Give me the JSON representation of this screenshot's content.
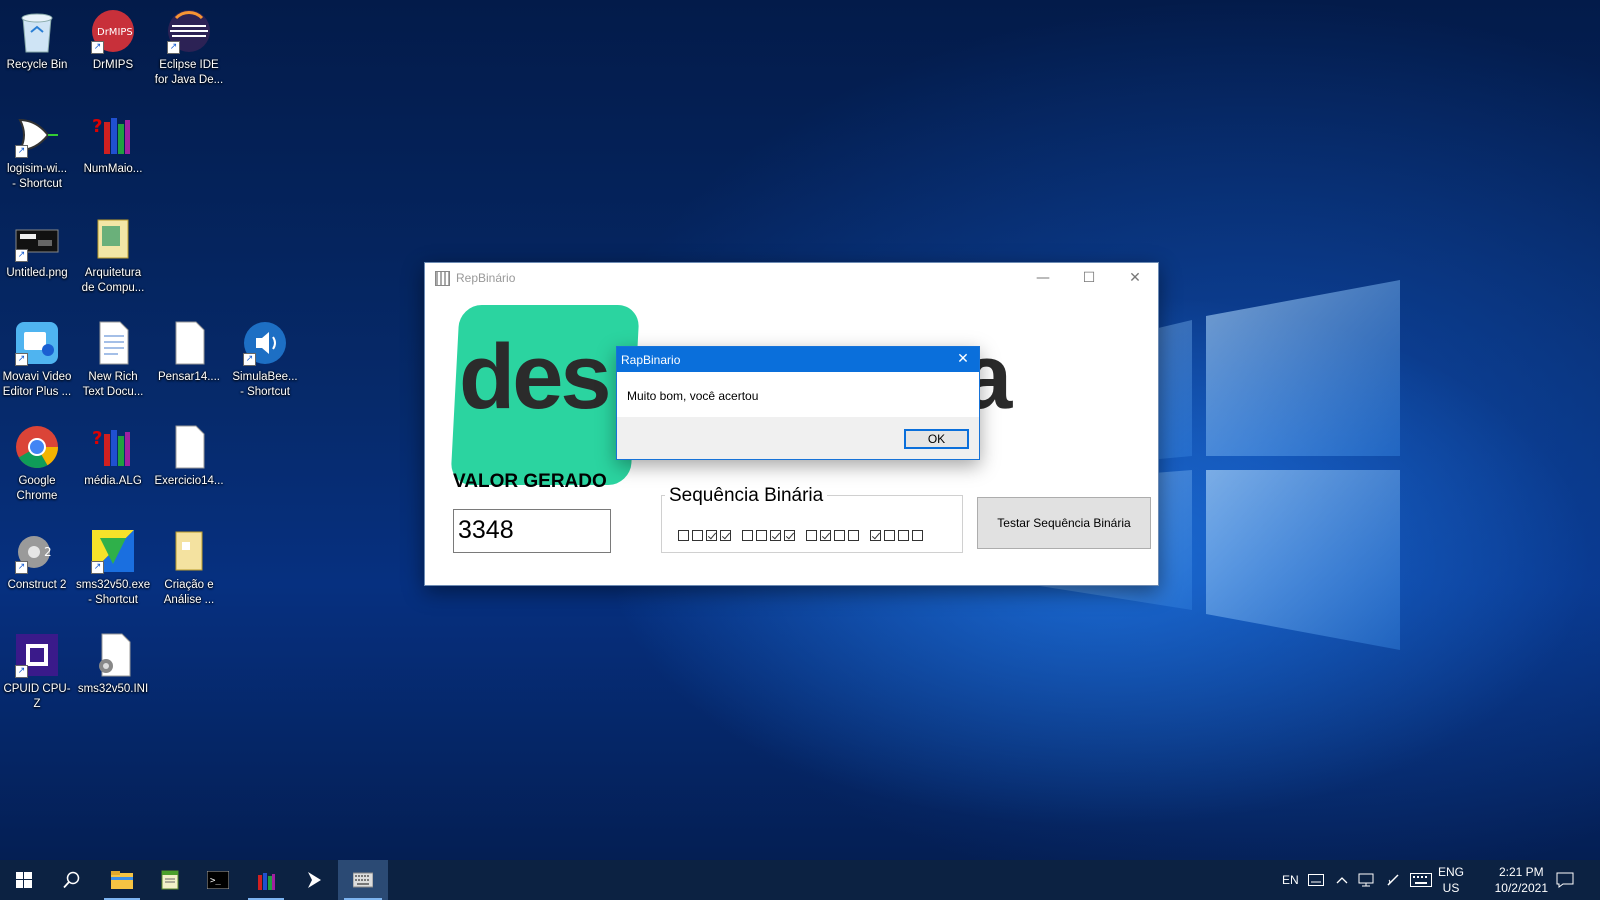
{
  "desktop": {
    "icons": [
      {
        "name": "recycle-bin",
        "label": [
          "Recycle Bin"
        ]
      },
      {
        "name": "drmips",
        "label": [
          "DrMIPS"
        ],
        "badge": "DrMIPS"
      },
      {
        "name": "eclipse",
        "label": [
          "Eclipse IDE",
          "for Java De..."
        ]
      },
      {
        "name": "logisim",
        "label": [
          "logisim-wi...",
          "- Shortcut"
        ]
      },
      {
        "name": "nummaior",
        "label": [
          "NumMaio..."
        ]
      },
      {
        "name": "untitled-png",
        "label": [
          "Untitled.png"
        ]
      },
      {
        "name": "arquitetura",
        "label": [
          "Arquitetura",
          "de Compu..."
        ]
      },
      {
        "name": "movavi",
        "label": [
          "Movavi Video",
          "Editor Plus ..."
        ]
      },
      {
        "name": "new-rich-text",
        "label": [
          "New Rich",
          "Text Docu..."
        ]
      },
      {
        "name": "pensar14",
        "label": [
          "Pensar14...."
        ]
      },
      {
        "name": "simulabee",
        "label": [
          "SimulaBee...",
          "- Shortcut"
        ]
      },
      {
        "name": "google-chrome",
        "label": [
          "Google",
          "Chrome"
        ]
      },
      {
        "name": "media-alg",
        "label": [
          "média.ALG"
        ]
      },
      {
        "name": "exercicio14",
        "label": [
          "Exercicio14..."
        ]
      },
      {
        "name": "construct2",
        "label": [
          "Construct 2"
        ]
      },
      {
        "name": "sms32v50",
        "label": [
          "sms32v50.exe",
          "- Shortcut"
        ]
      },
      {
        "name": "criacao",
        "label": [
          "Criação e",
          "Análise ..."
        ]
      },
      {
        "name": "cpuz",
        "label": [
          "CPUID CPU-Z"
        ]
      },
      {
        "name": "sms32v50-ini",
        "label": [
          "sms32v50.INI"
        ]
      }
    ]
  },
  "app": {
    "title": "RepBinário",
    "logo_left": "des",
    "logo_right": "ca",
    "valor_label": "VALOR GERADO",
    "valor_value": "3348",
    "seq_label": "Sequência Binária",
    "bits": [
      [
        false,
        false,
        true,
        true
      ],
      [
        false,
        false,
        true,
        true
      ],
      [
        false,
        true,
        false,
        false
      ],
      [
        true,
        false,
        false,
        false
      ]
    ],
    "test_button": "Testar Sequência Binária"
  },
  "dialog": {
    "title": "RapBinario",
    "message": "Muito bom, você acertou",
    "ok_label": "OK"
  },
  "taskbar": {
    "lang_top": "ENG",
    "lang_bottom": "US",
    "input_indicator": "EN",
    "time": "2:21 PM",
    "date": "10/2/2021"
  },
  "colors": {
    "logo_green": "#2bd4a0",
    "dialog_title": "#0a6fdb",
    "taskbar": "#0c2242"
  }
}
